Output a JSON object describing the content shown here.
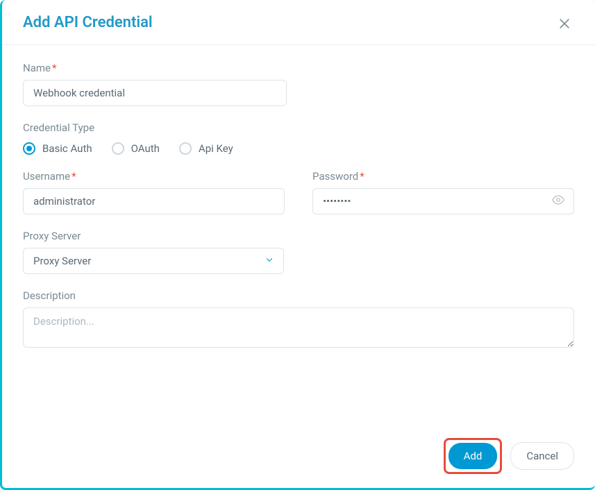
{
  "modal": {
    "title": "Add API Credential"
  },
  "form": {
    "name": {
      "label": "Name",
      "value": "Webhook credential"
    },
    "credentialType": {
      "label": "Credential Type",
      "options": [
        "Basic Auth",
        "OAuth",
        "Api Key"
      ],
      "selected": "Basic Auth"
    },
    "username": {
      "label": "Username",
      "value": "administrator"
    },
    "password": {
      "label": "Password",
      "value": "••••••••"
    },
    "proxyServer": {
      "label": "Proxy Server",
      "value": "Proxy Server"
    },
    "description": {
      "label": "Description",
      "placeholder": "Description..."
    }
  },
  "buttons": {
    "add": "Add",
    "cancel": "Cancel"
  }
}
